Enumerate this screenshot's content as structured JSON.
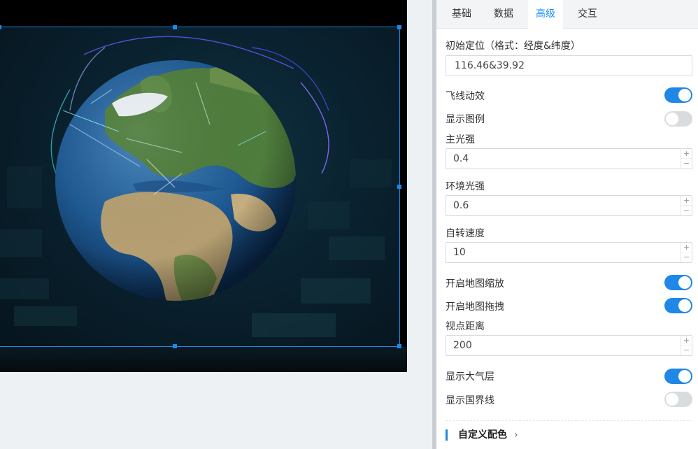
{
  "tabs": [
    {
      "label": "基础"
    },
    {
      "label": "数据"
    },
    {
      "label": "高级",
      "active": true
    },
    {
      "label": "交互"
    }
  ],
  "settings": {
    "initial_position": {
      "label": "初始定位（格式：经度&纬度）",
      "value": "116.46&39.92"
    },
    "flyline_animation": {
      "label": "飞线动效",
      "on": true
    },
    "show_legend": {
      "label": "显示图例",
      "on": false
    },
    "main_light": {
      "label": "主光强",
      "value": "0.4"
    },
    "ambient_light": {
      "label": "环境光强",
      "value": "0.6"
    },
    "rotation_speed": {
      "label": "自转速度",
      "value": "10"
    },
    "map_zoom": {
      "label": "开启地图缩放",
      "on": true
    },
    "map_drag": {
      "label": "开启地图拖拽",
      "on": true
    },
    "view_distance": {
      "label": "视点距离",
      "value": "200"
    },
    "show_atmosphere": {
      "label": "显示大气层",
      "on": true
    },
    "show_borders": {
      "label": "显示国界线",
      "on": false
    }
  },
  "stepper": {
    "plus": "+",
    "minus": "−"
  },
  "section": {
    "label": "自定义配色",
    "chevron": "›"
  },
  "colors": {
    "accent": "#1f87e5",
    "toggle_off": "#d9dcdf",
    "selection": "#1e88e5"
  }
}
